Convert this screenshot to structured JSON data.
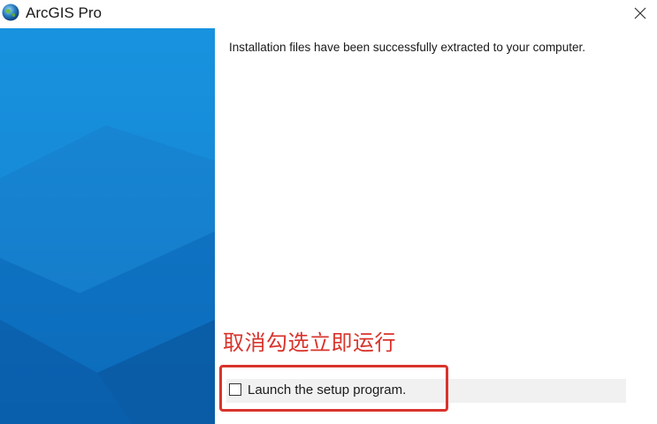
{
  "window": {
    "title": "ArcGIS Pro",
    "icon": "arcgis-globe-icon",
    "close_icon": "close-icon"
  },
  "side_panel": {
    "colors": {
      "top": "#1487d8",
      "bottom": "#0a63b3",
      "facet_light": "#2b9ae6",
      "facet_dark": "#0a5aa4"
    }
  },
  "content": {
    "message": "Installation files have been successfully extracted to your computer.",
    "annotation": "取消勾选立即运行",
    "annotation_color": "#d8342c",
    "launch_checkbox": {
      "label": "Launch the setup program.",
      "checked": false
    }
  }
}
